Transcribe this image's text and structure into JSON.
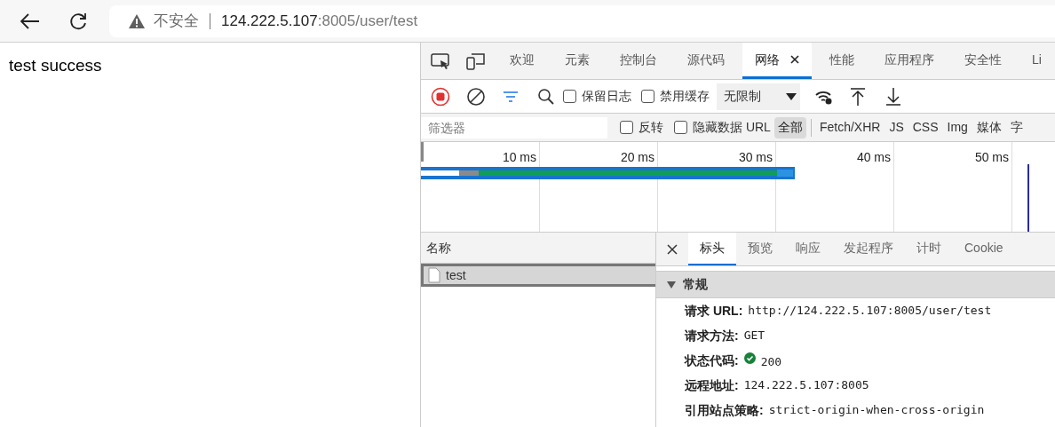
{
  "browser": {
    "security_label": "不安全",
    "url_host": "124.222.5.107",
    "url_rest": ":8005/user/test"
  },
  "page": {
    "text": "test success"
  },
  "devtools": {
    "tabs": [
      {
        "label": "欢迎",
        "selected": false
      },
      {
        "label": "元素",
        "selected": false
      },
      {
        "label": "控制台",
        "selected": false
      },
      {
        "label": "源代码",
        "selected": false
      },
      {
        "label": "网络",
        "selected": true,
        "closable": true
      },
      {
        "label": "性能",
        "selected": false
      },
      {
        "label": "应用程序",
        "selected": false
      },
      {
        "label": "安全性",
        "selected": false
      },
      {
        "label": "Li",
        "selected": false
      }
    ],
    "toolbar": {
      "preserve_log": {
        "label": "保留日志",
        "checked": false
      },
      "disable_cache": {
        "label": "禁用缓存",
        "checked": false
      },
      "throttling": "无限制"
    },
    "filter": {
      "placeholder": "筛选器",
      "invert": {
        "label": "反转",
        "checked": false
      },
      "hide_data_urls": {
        "label": "隐藏数据 URL",
        "checked": false
      },
      "types": [
        {
          "label": "全部",
          "selected": true
        },
        {
          "label": "Fetch/XHR",
          "selected": false
        },
        {
          "label": "JS",
          "selected": false
        },
        {
          "label": "CSS",
          "selected": false
        },
        {
          "label": "Img",
          "selected": false
        },
        {
          "label": "媒体",
          "selected": false
        },
        {
          "label": "字",
          "selected": false
        }
      ]
    },
    "timeline": {
      "ticks": [
        "10 ms",
        "20 ms",
        "30 ms",
        "40 ms",
        "50 ms"
      ]
    },
    "requests": {
      "header": "名称",
      "rows": [
        {
          "name": "test",
          "selected": true
        }
      ]
    },
    "detail_tabs": [
      {
        "label": "标头",
        "selected": true
      },
      {
        "label": "预览",
        "selected": false
      },
      {
        "label": "响应",
        "selected": false
      },
      {
        "label": "发起程序",
        "selected": false
      },
      {
        "label": "计时",
        "selected": false
      },
      {
        "label": "Cookie",
        "selected": false
      }
    ],
    "general": {
      "title": "常规",
      "expanded": true,
      "rows": [
        {
          "label": "请求 URL:",
          "value": "http://124.222.5.107:8005/user/test"
        },
        {
          "label": "请求方法:",
          "value": "GET"
        },
        {
          "label": "状态代码:",
          "value": "200",
          "kind": "status"
        },
        {
          "label": "远程地址:",
          "value": "124.222.5.107:8005"
        },
        {
          "label": "引用站点策略:",
          "value": "strict-origin-when-cross-origin"
        }
      ]
    }
  }
}
